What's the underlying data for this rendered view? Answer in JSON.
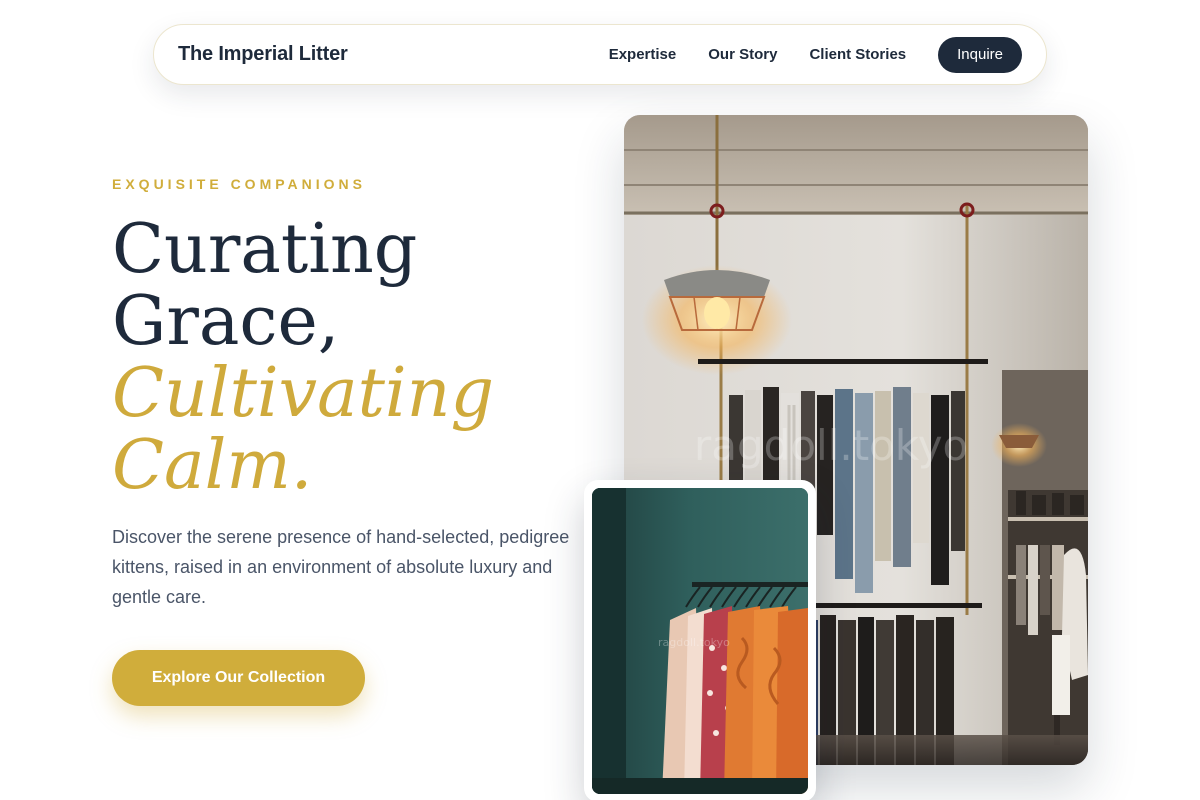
{
  "nav": {
    "brand": "The Imperial Litter",
    "links": [
      {
        "label": "Expertise"
      },
      {
        "label": "Our Story"
      },
      {
        "label": "Client Stories"
      }
    ],
    "cta_label": "Inquire"
  },
  "hero": {
    "eyebrow": "EXQUISITE COMPANIONS",
    "headline_lines": [
      "Curating",
      "Grace,"
    ],
    "headline_accent_lines": [
      "Cultivating",
      "Calm."
    ],
    "description": "Discover the serene presence of hand-selected, pedigree kittens, raised in an environment of absolute luxury and gentle care.",
    "cta_label": "Explore Our Collection"
  },
  "images": {
    "main_watermark": "ragdoll.tokyo",
    "small_watermark": "ragdoll.tokyo"
  },
  "colors": {
    "navy": "#1e2a3b",
    "gold": "#d0ad3b",
    "body_text": "#4a5568"
  }
}
